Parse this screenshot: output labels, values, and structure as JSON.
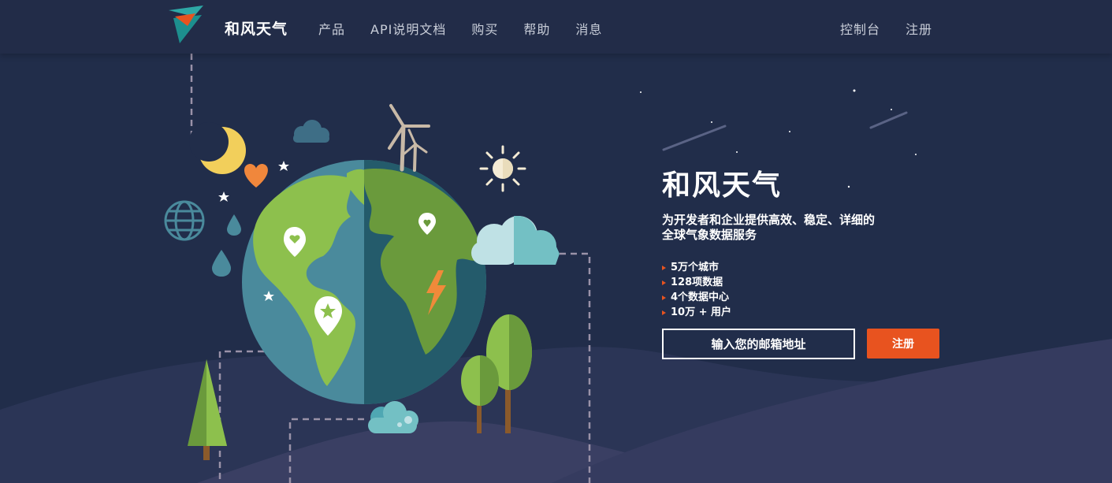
{
  "nav": {
    "brand": "和风天气",
    "links": [
      "产品",
      "API说明文档",
      "购买",
      "帮助",
      "消息"
    ],
    "right_links": [
      "控制台",
      "注册"
    ]
  },
  "hero": {
    "title": "和风天气",
    "subtitle_line1": "为开发者和企业提供高效、稳定、详细的",
    "subtitle_line2": "全球气象数据服务",
    "features": [
      "5万个城市",
      "128项数据",
      "4个数据中心",
      "10万 + 用户"
    ],
    "email_placeholder": "输入您的邮箱地址",
    "signup_label": "注册"
  },
  "colors": {
    "background": "#212d4a",
    "accent": "#e8531f",
    "globe_ocean": "#2a5a6e",
    "land_green": "#8dc04d"
  },
  "icons": [
    "logo-icon",
    "moon-icon",
    "heart-icon",
    "globe-grid-icon",
    "sun-icon",
    "cloud-icon",
    "wind-turbine-icon",
    "lightning-icon",
    "map-pin-icon",
    "tree-icon",
    "water-drop-icon",
    "star-icon"
  ]
}
